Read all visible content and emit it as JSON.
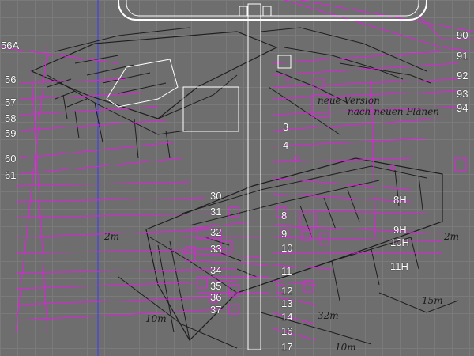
{
  "labels": {
    "l56a": "56A",
    "l56": "56",
    "l57": "57",
    "l58": "58",
    "l59": "59",
    "l60": "60",
    "l61": "61",
    "l90": "90",
    "l91": "91",
    "l92": "92",
    "l93": "93",
    "l94": "94",
    "l3": "3",
    "l4": "4",
    "l30": "30",
    "l31": "31",
    "l32": "32",
    "l33": "33",
    "l34": "34",
    "l35": "35",
    "l36": "36",
    "l37": "37",
    "l8": "8",
    "l9": "9",
    "l10": "10",
    "l11": "11",
    "l12": "12",
    "l13": "13",
    "l14": "14",
    "l16": "16",
    "l17": "17",
    "l8h": "8H",
    "l9h": "9H",
    "l10h": "10H",
    "l11h": "11H"
  },
  "notes": {
    "n1": "neue Version",
    "n2": "nach neuen Plänen",
    "n3": "2m",
    "n4": "2m",
    "n5": "10m",
    "n6": "32m",
    "n7": "15m",
    "n8": "10m"
  },
  "colors": {
    "background": "#6e6e6e",
    "grid": "#7a7a7a",
    "guide_line": "#e020e0",
    "selection": "#ffffff",
    "axis_blue": "#3a3aff",
    "sketch": "#1e1e1e"
  }
}
